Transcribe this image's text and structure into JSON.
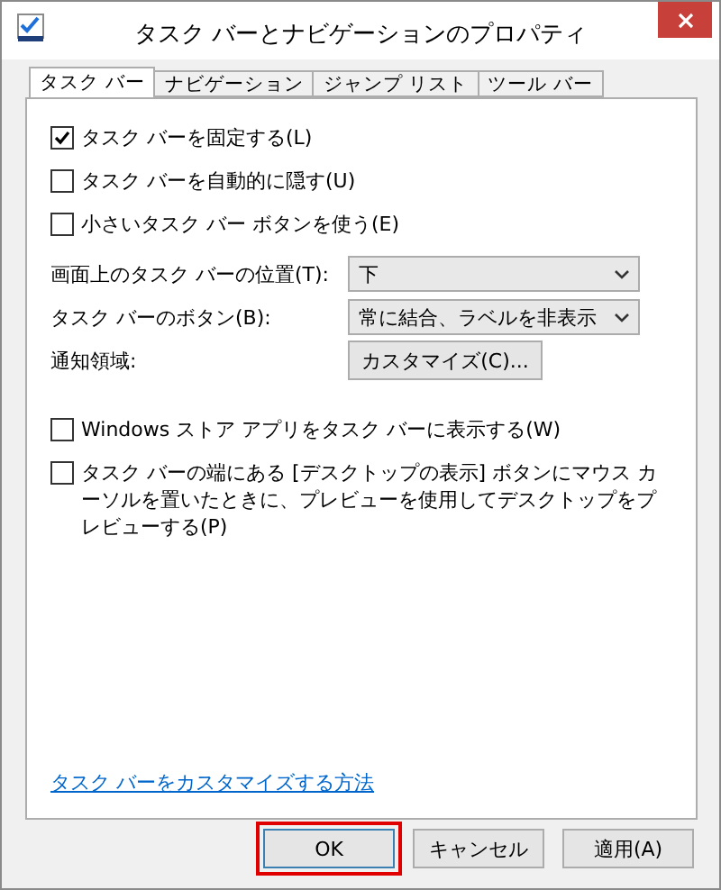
{
  "window": {
    "title": "タスク バーとナビゲーションのプロパティ"
  },
  "tabs": [
    {
      "label": "タスク バー",
      "selected": true
    },
    {
      "label": "ナビゲーション",
      "selected": false
    },
    {
      "label": "ジャンプ リスト",
      "selected": false
    },
    {
      "label": "ツール バー",
      "selected": false
    }
  ],
  "options": [
    {
      "label": "タスク バーを固定する(L)",
      "checked": true
    },
    {
      "label": "タスク バーを自動的に隠す(U)",
      "checked": false
    },
    {
      "label": "小さいタスク バー ボタンを使う(E)",
      "checked": false
    }
  ],
  "settings": [
    {
      "label": "画面上のタスク バーの位置(T):",
      "kind": "dropdown",
      "value": "下"
    },
    {
      "label": "タスク バーのボタン(B):",
      "kind": "dropdown",
      "value": "常に結合、ラベルを非表示"
    },
    {
      "label": "通知領域:",
      "kind": "button",
      "value": "カスタマイズ(C)..."
    }
  ],
  "more_options": [
    {
      "label": "Windows ストア アプリをタスク バーに表示する(W)",
      "checked": false
    },
    {
      "label": "タスク バーの端にある [デスクトップの表示] ボタンにマウス カーソルを置いたときに、プレビューを使用してデスクトップをプレビューする(P)",
      "checked": false
    }
  ],
  "help_link": "タスク バーをカスタマイズする方法",
  "buttons": [
    {
      "label": "OK",
      "highlighted": true
    },
    {
      "label": "キャンセル",
      "highlighted": false
    },
    {
      "label": "適用(A)",
      "highlighted": false
    }
  ]
}
